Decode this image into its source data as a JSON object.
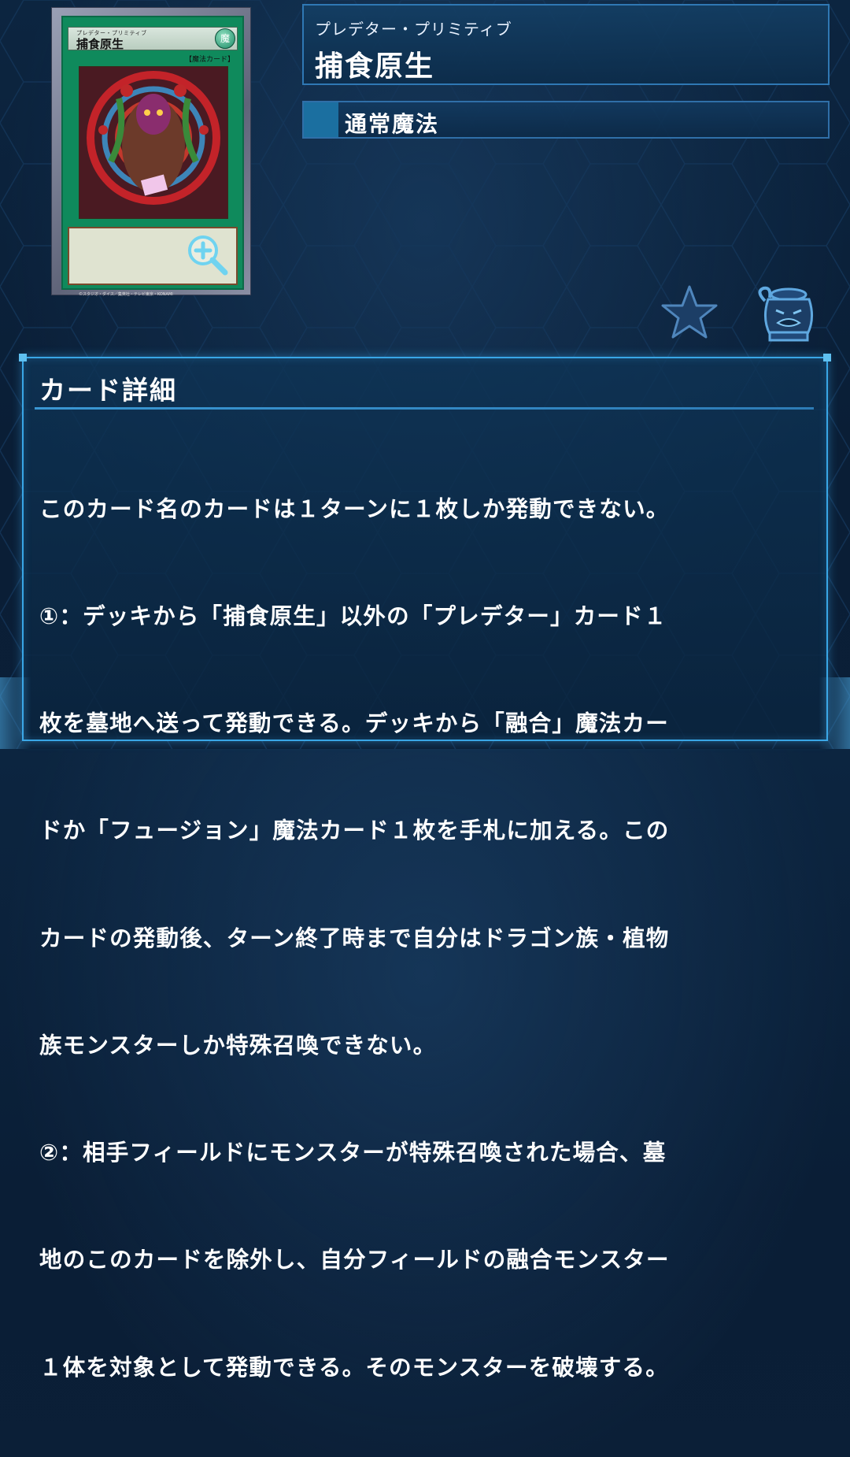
{
  "card": {
    "image_ruby": "プレデター・プリミティブ",
    "image_title": "捕食原生",
    "attribute": "魔",
    "type_line": "【魔法カード】",
    "footer_text": "©スタジオ・ダイス／集英社・テレビ東京・KONAMI"
  },
  "header": {
    "name_ruby": "プレデター・プリミティブ",
    "name": "捕食原生",
    "card_type": "通常魔法"
  },
  "icons": {
    "favorite": "star-icon",
    "pot": "pot-of-greed-icon",
    "zoom": "zoom-in-icon"
  },
  "details": {
    "heading": "カード詳細",
    "lines": [
      "このカード名のカードは１ターンに１枚しか発動できない。",
      "①：デッキから「捕食原生」以外の「プレデター」カード１",
      "枚を墓地へ送って発動できる。デッキから「融合」魔法カー",
      "ドか「フュージョン」魔法カード１枚を手札に加える。この",
      "カードの発動後、ターン終了時まで自分はドラゴン族・植物",
      "族モンスターしか特殊召喚できない。",
      "②：相手フィールドにモンスターが特殊召喚された場合、墓",
      "地のこのカードを除外し、自分フィールドの融合モンスター",
      "１体を対象として発動できる。そのモンスターを破壊する。"
    ]
  },
  "colors": {
    "background": "#0a2038",
    "panel_border": "#2f78b4",
    "detail_border": "#39a6e6",
    "spell_card_green": "#0f8a5c"
  }
}
